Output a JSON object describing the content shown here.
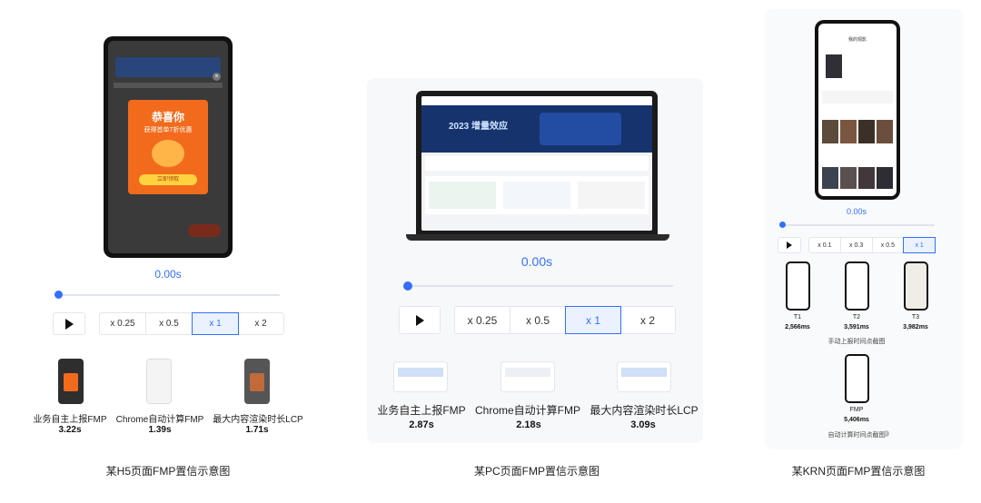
{
  "h5": {
    "popup_title": "恭喜你",
    "popup_sub": "获得首单7折优惠",
    "popup_button": "立即领取",
    "time": "0.00s",
    "speeds": [
      "x 0.25",
      "x 0.5",
      "x 1",
      "x 2"
    ],
    "active_speed": "x 1",
    "progress": 0.0,
    "metrics": [
      {
        "label": "业务自主上报FMP",
        "value": "3.22s"
      },
      {
        "label": "Chrome自动计算FMP",
        "value": "1.39s"
      },
      {
        "label": "最大内容渲染时长LCP",
        "value": "1.71s"
      }
    ],
    "caption": "某H5页面FMP置信示意图"
  },
  "pc": {
    "banner_text": "2023 增量效应",
    "time": "0.00s",
    "speeds": [
      "x 0.25",
      "x 0.5",
      "x 1",
      "x 2"
    ],
    "active_speed": "x 1",
    "progress": 0.0,
    "metrics": [
      {
        "label": "业务自主上报FMP",
        "value": "2.87s"
      },
      {
        "label": "Chrome自动计算FMP",
        "value": "2.18s"
      },
      {
        "label": "最大内容渲染时长LCP",
        "value": "3.09s"
      }
    ],
    "caption": "某PC页面FMP置信示意图"
  },
  "krn": {
    "screen_title": "我的观影",
    "time": "0.00s",
    "speeds": [
      "x 0.1",
      "x 0.3",
      "x 0.5",
      "x 1"
    ],
    "active_speed": "x 1",
    "progress": 0.0,
    "frames": [
      {
        "label": "T1",
        "value": "2,566ms"
      },
      {
        "label": "T2",
        "value": "3,591ms"
      },
      {
        "label": "T3",
        "value": "3,982ms"
      }
    ],
    "frames_caption": "手动上报时间点截图",
    "fmp": {
      "label": "FMP",
      "value": "5,406ms"
    },
    "fmp_caption": "自动计算时间点截图",
    "caption": "某KRN页面FMP置信示意图"
  },
  "colors": {
    "accent": "#3370ff",
    "popup": "#f26b1d"
  }
}
